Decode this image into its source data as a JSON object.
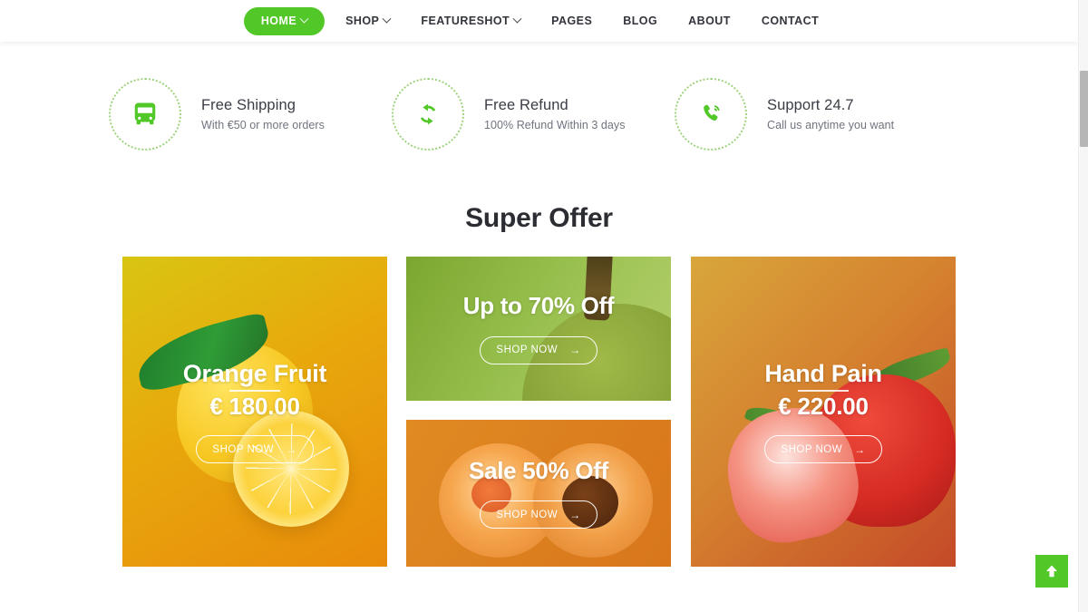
{
  "nav": {
    "items": [
      {
        "label": "HOME",
        "has_caret": true,
        "active": true
      },
      {
        "label": "SHOP",
        "has_caret": true,
        "active": false
      },
      {
        "label": "FEATURESHOT",
        "has_caret": true,
        "active": false
      },
      {
        "label": "PAGES",
        "has_caret": false,
        "active": false
      },
      {
        "label": "BLOG",
        "has_caret": false,
        "active": false
      },
      {
        "label": "ABOUT",
        "has_caret": false,
        "active": false
      },
      {
        "label": "CONTACT",
        "has_caret": false,
        "active": false
      }
    ],
    "active_color": "#51c728"
  },
  "features": [
    {
      "icon": "bus-icon",
      "title": "Free Shipping",
      "subtitle": "With €50 or more orders"
    },
    {
      "icon": "refresh-icon",
      "title": "Free Refund",
      "subtitle": "100% Refund Within 3 days"
    },
    {
      "icon": "phone-ring-icon",
      "title": "Support 24.7",
      "subtitle": "Call us anytime you want"
    }
  ],
  "section": {
    "title": "Super Offer"
  },
  "offers": [
    {
      "id": "orange-fruit",
      "title": "Orange Fruit",
      "price": "€ 180.00",
      "show_divider": true,
      "button_label": "SHOP NOW",
      "button_arrow": "→"
    },
    {
      "id": "up-to-70-off",
      "title": "Up to 70% Off",
      "price": "",
      "show_divider": false,
      "button_label": "SHOP NOW",
      "button_arrow": "→"
    },
    {
      "id": "sale-50-off",
      "title": "Sale 50% Off",
      "price": "",
      "show_divider": false,
      "button_label": "SHOP NOW",
      "button_arrow": "→"
    },
    {
      "id": "hand-pain",
      "title": "Hand Pain",
      "price": "€ 220.00",
      "show_divider": true,
      "button_label": "SHOP NOW",
      "button_arrow": "→"
    }
  ],
  "scroll_top": {
    "icon": "arrow-up-icon",
    "color": "#51c728"
  }
}
